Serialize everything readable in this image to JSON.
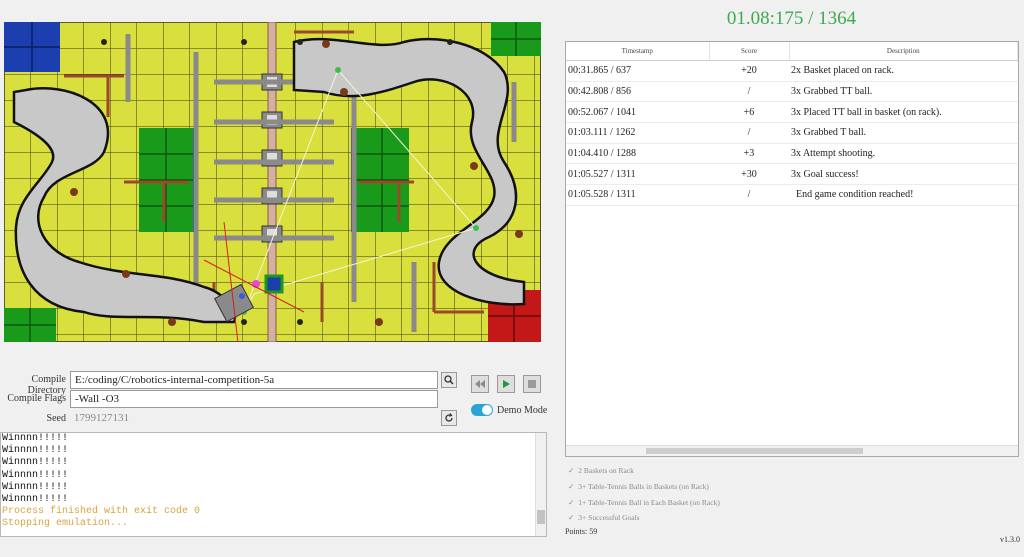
{
  "timer": "01.08:175 / 1364",
  "config": {
    "compile_directory_label": "Compile Directory",
    "compile_directory": "E:/coding/C/robotics-internal-competition-5a",
    "compile_flags_label": "Compile Flags",
    "compile_flags": "-Wall -O3",
    "seed_label": "Seed",
    "seed": "1799127131",
    "demo_mode_label": "Demo Mode",
    "demo_mode": true
  },
  "console": {
    "lines": [
      {
        "text": "Winnnn!!!!!",
        "type": "normal"
      },
      {
        "text": "Winnnn!!!!!",
        "type": "normal"
      },
      {
        "text": "Winnnn!!!!!",
        "type": "normal"
      },
      {
        "text": "Winnnn!!!!!",
        "type": "normal"
      },
      {
        "text": "Winnnn!!!!!",
        "type": "normal"
      },
      {
        "text": "Winnnn!!!!!",
        "type": "normal"
      },
      {
        "text": "Process finished with exit code 0",
        "type": "warn"
      },
      {
        "text": "Stopping emulation...",
        "type": "warn"
      }
    ]
  },
  "log": {
    "headers": [
      "Timestamp",
      "Score",
      "Description"
    ],
    "rows": [
      {
        "time": "00:31.865 / 637",
        "score": "+20",
        "desc": "2x Basket placed on rack."
      },
      {
        "time": "00:42.808 / 856",
        "score": "/",
        "desc": "3x Grabbed TT ball."
      },
      {
        "time": "00:52.067 / 1041",
        "score": "+6",
        "desc": "3x Placed TT ball in basket (on rack)."
      },
      {
        "time": "01:03.111 / 1262",
        "score": "/",
        "desc": "3x Grabbed T ball."
      },
      {
        "time": "01:04.410 / 1288",
        "score": "+3",
        "desc": "3x Attempt shooting."
      },
      {
        "time": "01:05.527 / 1311",
        "score": "+30",
        "desc": "3x Goal success!"
      },
      {
        "time": "01:05.528 / 1311",
        "score": "/",
        "desc": "  End game condition reached!"
      }
    ]
  },
  "objectives": [
    {
      "label": "2 Baskets on Rack",
      "done": true
    },
    {
      "label": "3+ Table-Tennis Balls in Baskets (on Rack)",
      "done": true
    },
    {
      "label": "1+ Table-Tennis Ball in Each Basket (on Rack)",
      "done": true
    },
    {
      "label": "3+ Successful Goals",
      "done": true
    }
  ],
  "points": "Points: 59",
  "version": "v1.3.0",
  "icons": {
    "search": "magnifier-icon",
    "refresh": "refresh-icon",
    "rewind": "rewind-icon",
    "play": "play-icon",
    "stop": "stop-icon",
    "check": "check-icon"
  },
  "colors": {
    "field_yellow": "#d9df3c",
    "path_gray": "#c8c8c8",
    "zone_green": "#1a9a1a",
    "zone_blue": "#1c3fb0",
    "zone_red": "#c21818",
    "timer_green": "#3bab4f",
    "toggle_blue": "#2aa3d6"
  }
}
